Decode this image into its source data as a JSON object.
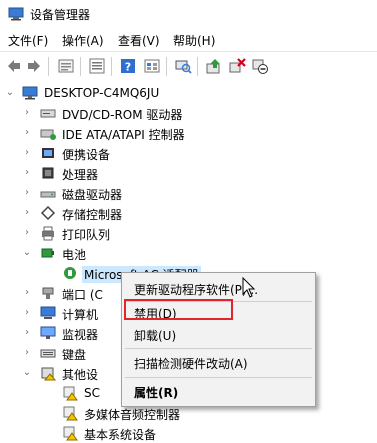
{
  "window": {
    "title": "设备管理器"
  },
  "menu": [
    "文件(F)",
    "操作(A)",
    "查看(V)",
    "帮助(H)"
  ],
  "toolbar": [
    "back-icon",
    "forward-icon",
    "properties-icon",
    "view-icon",
    "help-icon",
    "scan-icon",
    "update-driver-icon",
    "uninstall-icon",
    "disable-icon",
    "enable-icon"
  ],
  "tree": {
    "root": "DESKTOP-C4MQ6JU",
    "items": [
      "DVD/CD-ROM 驱动器",
      "IDE ATA/ATAPI 控制器",
      "便携设备",
      "处理器",
      "磁盘驱动器",
      "存储控制器",
      "打印队列",
      "电池",
      "Microsoft AC 适配器",
      "端口 (C",
      "计算机",
      "监视器",
      "键盘",
      "其他设",
      "SC",
      "多媒体音频控制器",
      "基本系统设备"
    ]
  },
  "context_menu": {
    "update": "更新驱动程序软件(P)...",
    "disable": "禁用(D)",
    "uninstall": "卸载(U)",
    "scan": "扫描检测硬件改动(A)",
    "properties": "属性(R)"
  },
  "colors": {
    "highlight_border": "#e0262b",
    "selection": "#cce8ff",
    "menu_bg": "#f2f2f2"
  }
}
